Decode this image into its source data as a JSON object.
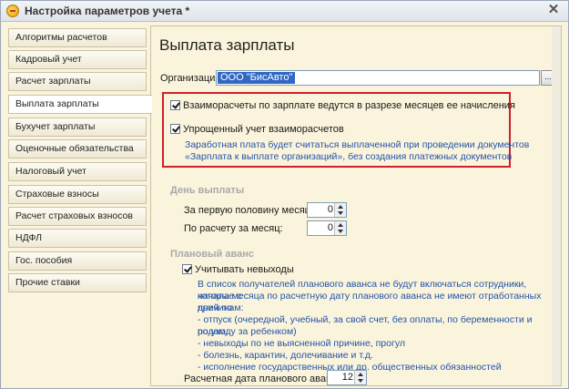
{
  "window": {
    "title": "Настройка параметров учета *"
  },
  "sidebar": {
    "tabs": [
      {
        "label": "Алгоритмы расчетов"
      },
      {
        "label": "Кадровый учет"
      },
      {
        "label": "Расчет зарплаты"
      },
      {
        "label": "Выплата зарплаты"
      },
      {
        "label": "Бухучет зарплаты"
      },
      {
        "label": "Оценочные обязательства"
      },
      {
        "label": "Налоговый учет"
      },
      {
        "label": "Страховые взносы"
      },
      {
        "label": "Расчет страховых взносов"
      },
      {
        "label": "НДФЛ"
      },
      {
        "label": "Гос. пособия"
      },
      {
        "label": "Прочие ставки"
      }
    ],
    "active_index": 3
  },
  "main": {
    "title": "Выплата зарплаты",
    "org_label": "Организация:",
    "org_value": "ООО \"БисАвто\"",
    "org_button": "...",
    "settlements_checkbox": {
      "label": "Взаиморасчеты по зарплате ведутся в разрезе месяцев ее начисления",
      "checked": true
    },
    "simplified_checkbox": {
      "label": "Упрощенный учет взаиморасчетов",
      "checked": true
    },
    "simplified_note_line1": "Заработная плата будет считаться выплаченной при проведении документов",
    "simplified_note_line2": "«Зарплата к выплате организаций», без создания платежных документов",
    "payday_section": "День выплаты",
    "first_half_label": "За первую половину месяца:",
    "first_half_value": "0",
    "monthly_label": "По расчету за месяц:",
    "monthly_value": "0",
    "advance_section": "Плановый аванс",
    "absences_checkbox": {
      "label": "Учитывать невыходы",
      "checked": true
    },
    "absences_note": [
      "В список получателей планового аванса не будут включаться сотрудники, которые с",
      "начала месяца по расчетную дату планового аванса не имеют отработанных дней по",
      "причинам:",
      "- отпуск (очередной, учебный, за свой счет, без оплаты, по беременности и родам,",
      "по уходу за ребенком)",
      "- невыходы по не выясненной причине, прогул",
      "- болезнь, карантин, долечивание и т.д.",
      "- исполнение государственных или др. общественных обязанностей"
    ],
    "advance_date_label": "Расчетная дата планового аванса:",
    "advance_date_value": "12"
  },
  "colors": {
    "highlight_border": "#d0202a",
    "note_text": "#2353a8",
    "selection": "#3168c5"
  }
}
